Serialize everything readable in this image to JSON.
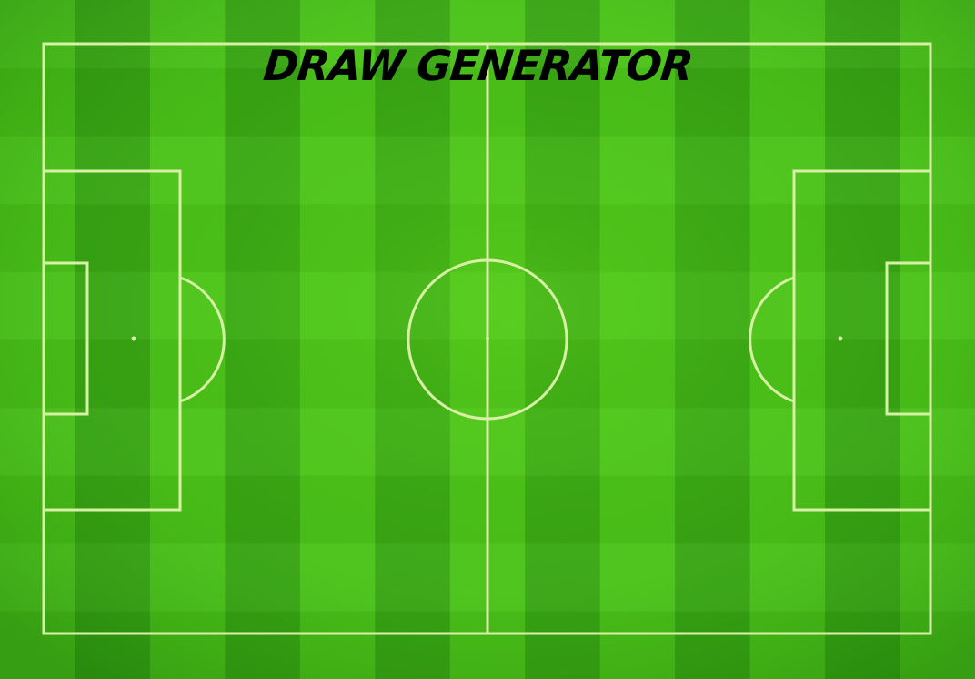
{
  "title": "DRAW GENERATOR",
  "colors": {
    "grass_light": "#4cc71a",
    "grass_dark": "#33a012",
    "line": "#d8f0a6",
    "title": "#000000"
  }
}
